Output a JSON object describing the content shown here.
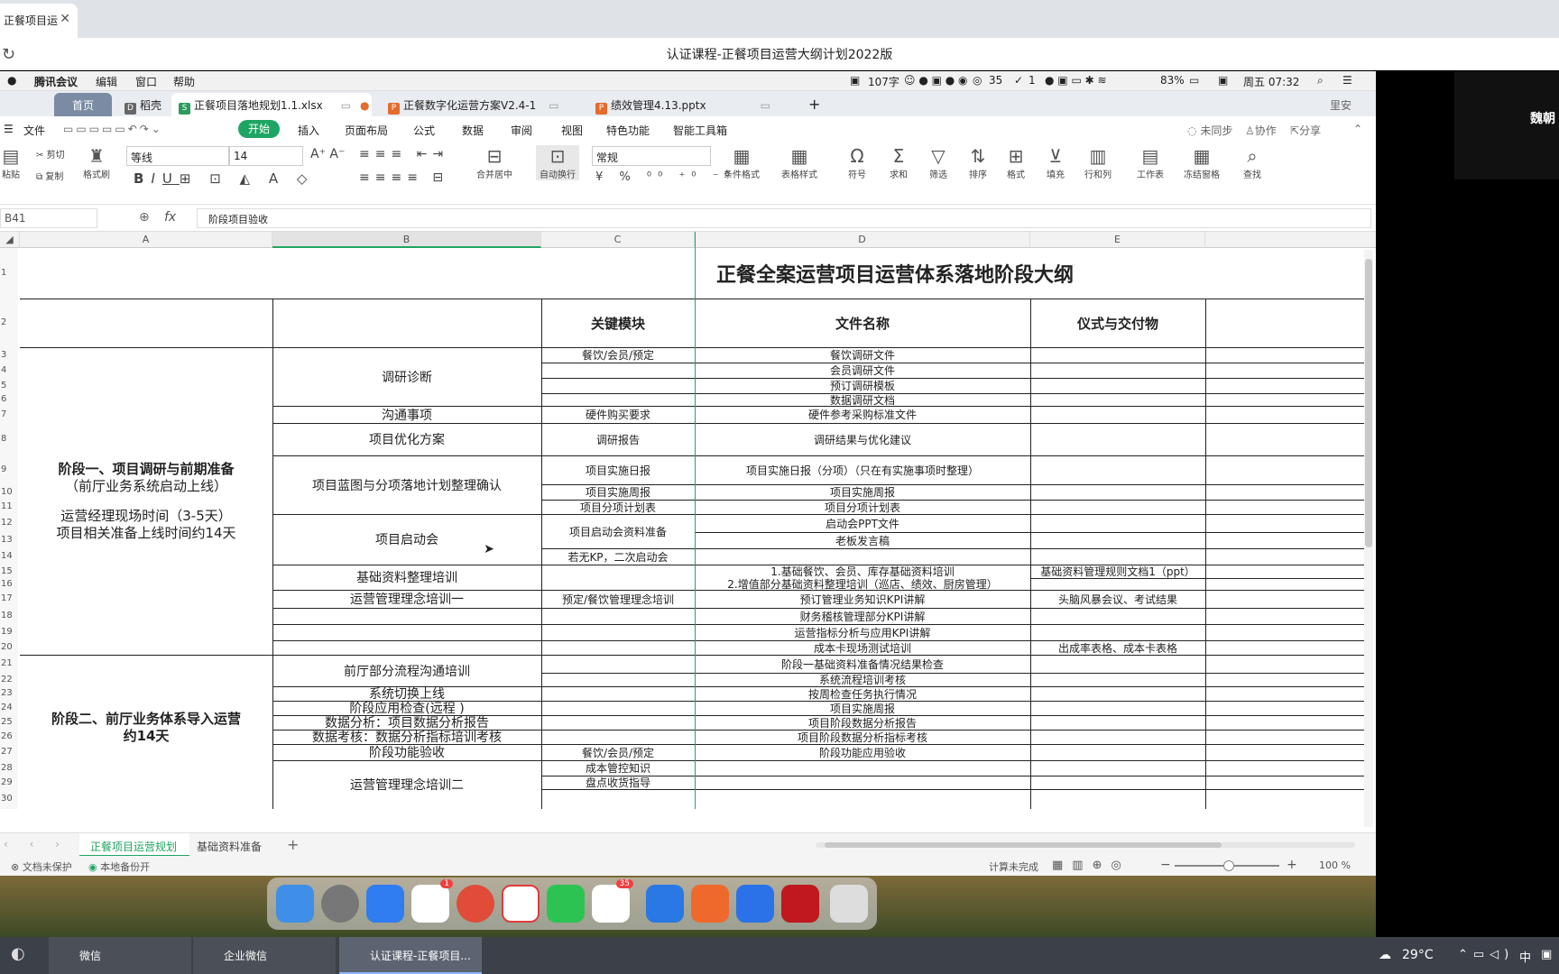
{
  "browser": {
    "tab_label": "正餐项目运",
    "window_title": "认证课程-正餐项目运营大纲计划2022版"
  },
  "mac_menu": {
    "app": "腾讯会议",
    "edit": "编辑",
    "window": "窗口",
    "help": "帮助",
    "status_chars": "107字",
    "status_a": "35",
    "status_b": "1",
    "battery": "83%",
    "clock": "周五 07:32"
  },
  "doc_tabs": {
    "home": "首页",
    "daoke": "稻壳",
    "tab1": "正餐项目落地规划1.1.xlsx",
    "tab2": "正餐数字化运营方案V2.4-1",
    "tab3": "绩效管理4.13.pptx",
    "user": "里安"
  },
  "menus": {
    "file": "文件",
    "start": "开始",
    "insert": "插入",
    "layout": "页面布局",
    "formula": "公式",
    "data": "数据",
    "review": "审阅",
    "view": "视图",
    "special": "特色功能",
    "smart": "智能工具箱",
    "unsynced": "未同步",
    "collab": "协作",
    "share": "分享"
  },
  "ribbon": {
    "paste": "粘贴",
    "cut": "剪切",
    "copy": "复制",
    "format_painter": "格式刷",
    "font": "等线",
    "font_size": "14",
    "merge": "合并居中",
    "wrap": "自动换行",
    "number_format": "常规",
    "cond": "条件格式",
    "table_style": "表格样式",
    "symbol": "符号",
    "sum": "求和",
    "filter": "筛选",
    "sort": "排序",
    "format": "格式",
    "fill": "填充",
    "rowcol": "行和列",
    "sheet": "工作表",
    "freeze": "冻结窗格",
    "find": "查找"
  },
  "formula": {
    "namebox": "B41",
    "fx": "fx",
    "content": "阶段项目验收"
  },
  "columns": [
    "A",
    "B",
    "C",
    "D",
    "E"
  ],
  "title": "正餐全案运营项目运营体系落地阶段大纲",
  "headers": {
    "c": "关键模块",
    "d": "文件名称",
    "e": "仪式与交付物"
  },
  "stage1": {
    "l1": "阶段一、项目调研与前期准备",
    "l2": "（前厅业务系统启动上线）",
    "l3": "运营经理现场时间（3-5天）",
    "l4": "项目相关准备上线时间约14天"
  },
  "stage2": {
    "l1": "阶段二、前厅业务体系导入运营",
    "l2": "约14天"
  },
  "b": {
    "r3": "调研诊断",
    "r7": "沟通事项",
    "r8": "项目优化方案",
    "r9": "项目蓝图与分项落地计划整理确认",
    "r12": "项目启动会",
    "r15": "基础资料整理培训",
    "r17": "运营管理理念培训一",
    "r21": "前厅部分流程沟通培训",
    "r23": "系统切换上线",
    "r24": "阶段应用检查(远程 )",
    "r25": "数据分析：项目数据分析报告",
    "r26": "数据考核：数据分析指标培训考核",
    "r27": "阶段功能验收",
    "r28": "运营管理理念培训二"
  },
  "c": {
    "r3": "餐饮/会员/预定",
    "r7": "硬件购买要求",
    "r8": "调研报告",
    "r9": "项目实施日报",
    "r10": "项目实施周报",
    "r11": "项目分项计划表",
    "r12": "项目启动会资料准备",
    "r14": "若无KP，二次启动会",
    "r17": "预定/餐饮管理理念培训",
    "r27": "餐饮/会员/预定",
    "r28": "成本管控知识",
    "r29": "盘点收货指导"
  },
  "d": {
    "r3": "餐饮调研文件",
    "r4": "会员调研文件",
    "r5": "预订调研模板",
    "r6": "数据调研文档",
    "r7": "硬件参考采购标准文件",
    "r8": "调研结果与优化建议",
    "r9": "项目实施日报（分项）（只在有实施事项时整理）",
    "r10": "项目实施周报",
    "r11": "项目分项计划表",
    "r12": "启动会PPT文件",
    "r13": "老板发言稿",
    "r15": "1.基础餐饮、会员、库存基础资料培训",
    "r16": "2.增值部分基础资料整理培训（巡店、绩效、厨房管理）",
    "r17": "预订管理业务知识KPI讲解",
    "r18": "财务稽核管理部分KPI讲解",
    "r19": "运营指标分析与应用KPI讲解",
    "r20": "成本卡现场测试培训",
    "r21": "阶段一基础资料准备情况结果检查",
    "r22": "系统流程培训考核",
    "r23": "按周检查任务执行情况",
    "r24": "项目实施周报",
    "r25": "项目阶段数据分析报告",
    "r26": "项目阶段数据分析指标考核",
    "r27": "阶段功能应用验收"
  },
  "e": {
    "r15": "基础资料管理规则文档1（ppt）",
    "r17": "头脑风暴会议、考试结果",
    "r20": "出成率表格、成本卡表格"
  },
  "sheet_tabs": {
    "tab1": "正餐项目运营规划",
    "tab2": "基础资料准备"
  },
  "status": {
    "protect": "文档未保护",
    "backup": "本地备份开",
    "calc": "计算未完成",
    "zoom": "100 %"
  },
  "video": {
    "name": "魏朝"
  },
  "taskbar": {
    "wechat": "微信",
    "wework": "企业微信",
    "course": "认证课程-正餐项目...",
    "weather": "29°C",
    "ime": "中"
  },
  "colors": {
    "wps_green": "#1fa563",
    "xlsx": "#2a9d5c",
    "ppt_orange": "#e46c2c"
  }
}
